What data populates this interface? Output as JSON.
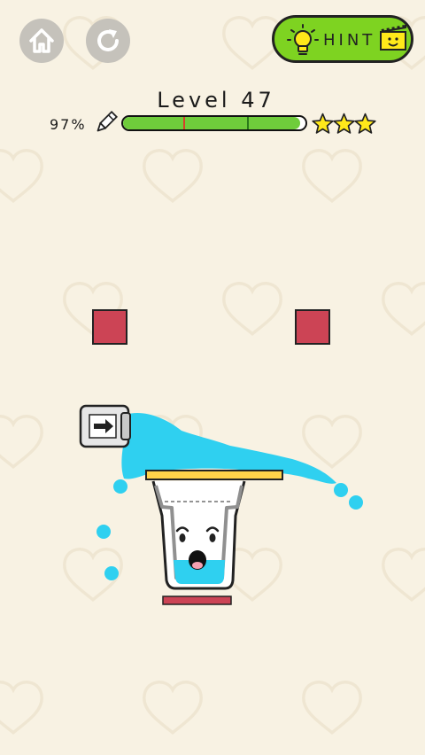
{
  "header": {
    "level_label": "Level 47",
    "progress_text": "97%",
    "progress_value": 0.97,
    "stars_earned": 3,
    "stars_total": 3
  },
  "buttons": {
    "home_icon": "home-icon",
    "restart_icon": "restart-icon",
    "hint_label": "HINT"
  },
  "colors": {
    "background": "#f8f2e3",
    "hint_button": "#7ed321",
    "progress_fill": "#6fcc3b",
    "star": "#ffe81a",
    "water": "#2fd0f0",
    "block": "#cc4455",
    "platform": "#ffd24a"
  }
}
